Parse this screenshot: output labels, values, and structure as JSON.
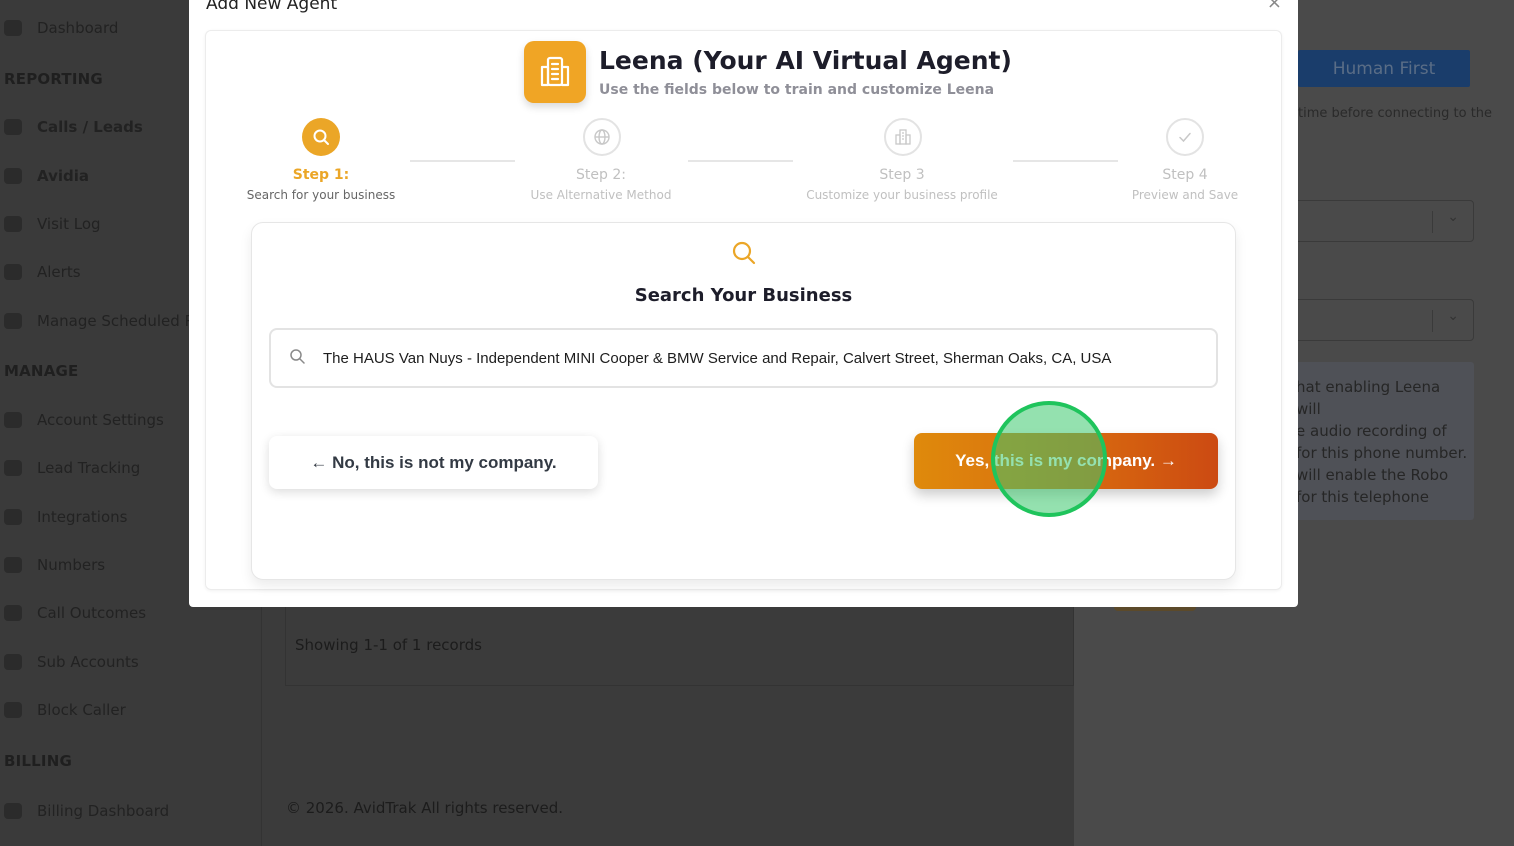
{
  "sidebar": {
    "items": [
      {
        "label": "Dashboard",
        "bold": false
      },
      {
        "label": "Calls / Leads",
        "bold": true
      },
      {
        "label": "Avidia",
        "bold": true
      },
      {
        "label": "Visit Log",
        "bold": false
      },
      {
        "label": "Alerts",
        "bold": false
      },
      {
        "label": "Manage Scheduled Re",
        "bold": false
      },
      {
        "label": "Account Settings",
        "bold": false
      },
      {
        "label": "Lead Tracking",
        "bold": false
      },
      {
        "label": "Integrations",
        "bold": false
      },
      {
        "label": "Numbers",
        "bold": false
      },
      {
        "label": "Call Outcomes",
        "bold": false
      },
      {
        "label": "Sub Accounts",
        "bold": false
      },
      {
        "label": "Block Caller",
        "bold": false
      },
      {
        "label": "Billing Dashboard",
        "bold": false
      }
    ],
    "sections": {
      "reporting": "REPORTING",
      "manage": "MANAGE",
      "billing": "BILLING"
    }
  },
  "main": {
    "records_text": "Showing 1-1 of 1 records",
    "footer_text": "© 2026. AvidTrak All rights reserved."
  },
  "right_panel": {
    "human_first_label": "Human First",
    "hint_text": "time before connecting to the",
    "info_lines": [
      "hat enabling Leena will",
      "e audio recording of",
      "for this phone number.",
      "will enable the Robo",
      "for this telephone"
    ]
  },
  "modal": {
    "title": "Add New Agent",
    "close_symbol": "×",
    "agent_name": "Leena (Your AI Virtual Agent)",
    "agent_subtitle": "Use the fields below to train and customize Leena",
    "steps": [
      {
        "label": "Step 1:",
        "description": "Search for your business",
        "icon": "search-icon",
        "active": true
      },
      {
        "label": "Step 2:",
        "description": "Use Alternative Method",
        "icon": "globe-icon",
        "active": false
      },
      {
        "label": "Step 3",
        "description": "Customize your business profile",
        "icon": "building-icon",
        "active": false
      },
      {
        "label": "Step 4",
        "description": "Preview and Save",
        "icon": "check-icon",
        "active": false
      }
    ],
    "search": {
      "heading": "Search Your Business",
      "value": "The HAUS Van Nuys - Independent MINI Cooper & BMW Service and Repair, Calvert Street, Sherman Oaks, CA, USA"
    },
    "no_button_label": "← No, this is not my company.",
    "yes_button_label": "Yes, this is my company. →"
  },
  "colors": {
    "accent": "#eba627",
    "yes_gradient_start": "#df8a0c",
    "yes_gradient_end": "#cc4a12",
    "click_marker": "#1fc45c"
  }
}
